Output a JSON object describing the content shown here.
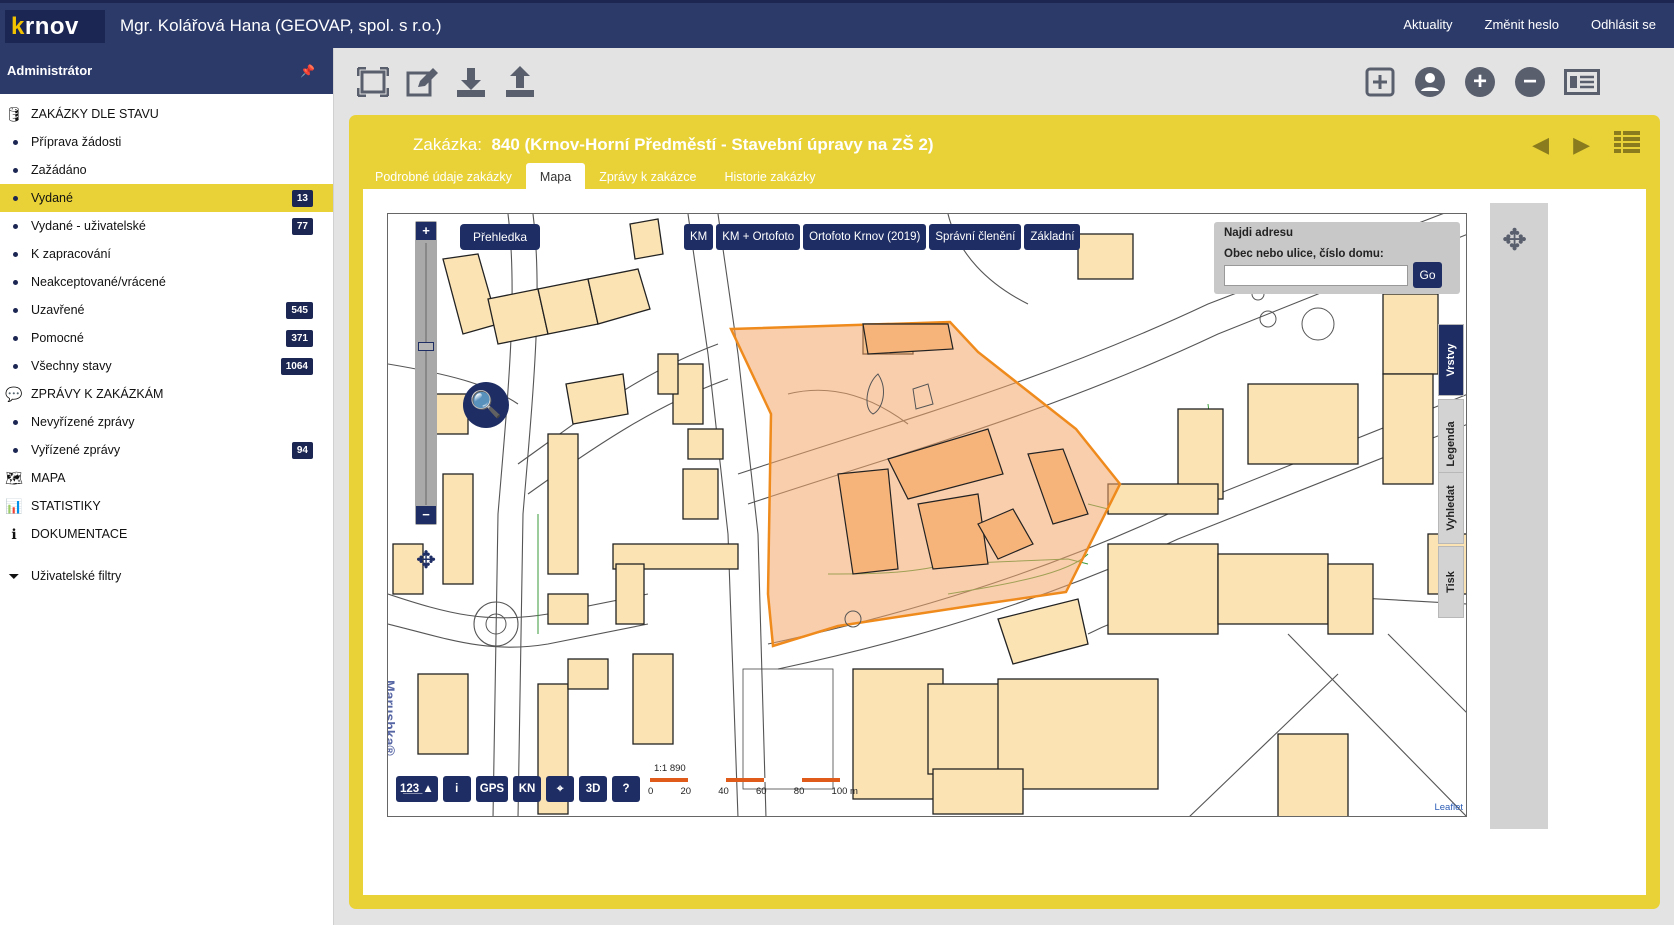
{
  "header": {
    "logo_k": "k",
    "logo_rest": "rnov",
    "user": "Mgr. Kolářová Hana (GEOVAP, spol. s r.o.)",
    "nav": [
      "Aktuality",
      "Změnit heslo",
      "Odhlásit se"
    ]
  },
  "sidebar": {
    "title": "Administrátor",
    "sections": {
      "zakazky": "ZAKÁZKY DLE STAVU",
      "zpravy": "ZPRÁVY K ZAKÁZKÁM",
      "mapa": "MAPA",
      "statistiky": "STATISTIKY",
      "dokumentace": "DOKUMENTACE",
      "filtry": "Uživatelské filtry"
    },
    "items": [
      {
        "label": "Příprava žádosti",
        "badge": ""
      },
      {
        "label": "Zažádáno",
        "badge": ""
      },
      {
        "label": "Vydané",
        "badge": "13"
      },
      {
        "label": "Vydané - uživatelské",
        "badge": "77"
      },
      {
        "label": "K zapracování",
        "badge": ""
      },
      {
        "label": "Neakceptované/vrácené",
        "badge": ""
      },
      {
        "label": "Uzavřené",
        "badge": "545"
      },
      {
        "label": "Pomocné",
        "badge": "371"
      },
      {
        "label": "Všechny stavy",
        "badge": "1064"
      }
    ],
    "zpravy_items": [
      {
        "label": "Nevyřízené zprávy",
        "badge": ""
      },
      {
        "label": "Vyřízené zprávy",
        "badge": "94"
      }
    ]
  },
  "toolbar": {
    "left_icons": [
      "extent-icon",
      "edit-icon",
      "download-icon",
      "upload-icon"
    ],
    "right_icons": [
      "add-square-icon",
      "user-icon",
      "zoom-in-icon",
      "zoom-out-icon",
      "list-view-icon"
    ]
  },
  "order": {
    "label": "Zakázka:",
    "title": "840 (Krnov-Horní Předměstí - Stavební úpravy na ZŠ 2)"
  },
  "tabs": [
    "Podrobné údaje zakázky",
    "Mapa",
    "Zprávy k zakázce",
    "Historie zakázky"
  ],
  "map": {
    "overview": "Přehledka",
    "layers": [
      "KM",
      "KM + Ortofoto",
      "Ortofoto Krnov (2019)",
      "Správní členění",
      "Základní"
    ],
    "find_title": "Najdi adresu",
    "find_label": "Obec nebo ulice, číslo domu:",
    "find_value": "",
    "find_go": "Go",
    "side_tabs": [
      "Vrstvy",
      "Legenda",
      "Vyhledat",
      "Tisk"
    ],
    "bottom_tools": [
      "1̲2̲3̲ ▲",
      "i",
      "GPS",
      "KN",
      "⌖",
      "3D",
      "?"
    ],
    "scale_text": "1:1 890",
    "scale_labels": [
      "0",
      "20",
      "40",
      "60",
      "80",
      "100 m"
    ],
    "brand": "Marushka®",
    "attribution": "Leaflet",
    "colors": {
      "building": "#fbe3b4",
      "parcel": "#f4a56a",
      "outline": "#ef8a1c",
      "ui": "#1e2d63"
    }
  }
}
